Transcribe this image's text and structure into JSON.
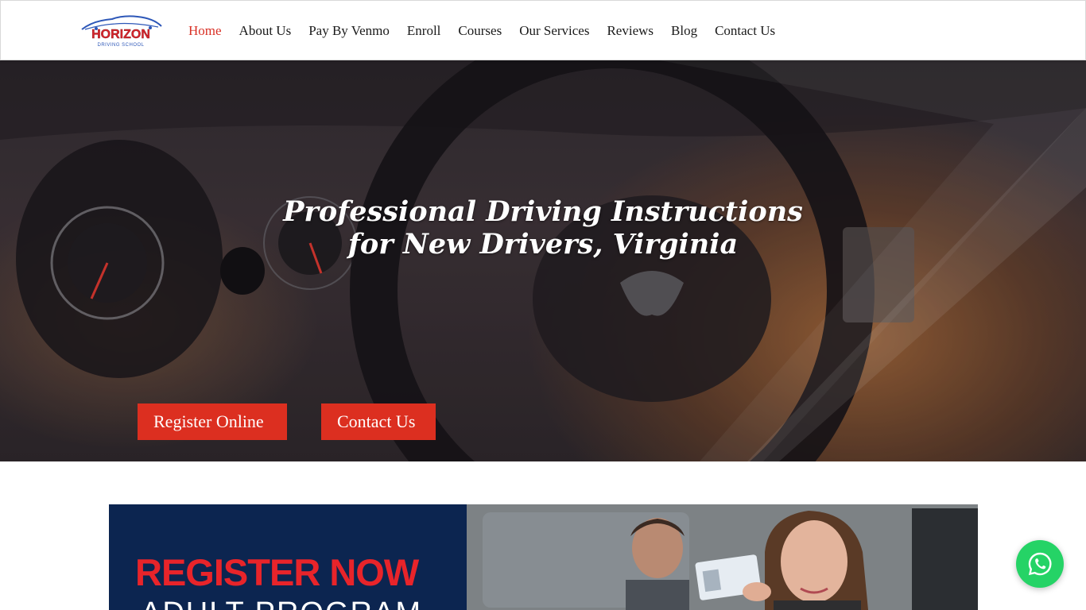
{
  "brand": {
    "name": "HORIZON",
    "tagline": "DRIVING SCHOOL"
  },
  "nav": {
    "items": [
      {
        "label": "Home",
        "active": true
      },
      {
        "label": "About Us"
      },
      {
        "label": "Pay By Venmo"
      },
      {
        "label": "Enroll"
      },
      {
        "label": "Courses"
      },
      {
        "label": "Our Services"
      },
      {
        "label": "Reviews"
      },
      {
        "label": "Blog"
      },
      {
        "label": "Contact Us"
      }
    ]
  },
  "hero": {
    "title_line1": "Professional Driving Instructions",
    "title_line2": "for New Drivers, Virginia",
    "register_label": "Register Online",
    "contact_label": "Contact Us"
  },
  "banner": {
    "title": "REGISTER NOW",
    "subtitle": "ADULT PROGRAM"
  },
  "colors": {
    "accent": "#dc2f20",
    "active_nav": "#d93025",
    "banner_bg": "#0c2550",
    "whatsapp": "#25d366"
  },
  "icons": {
    "chat": "whatsapp-icon"
  }
}
